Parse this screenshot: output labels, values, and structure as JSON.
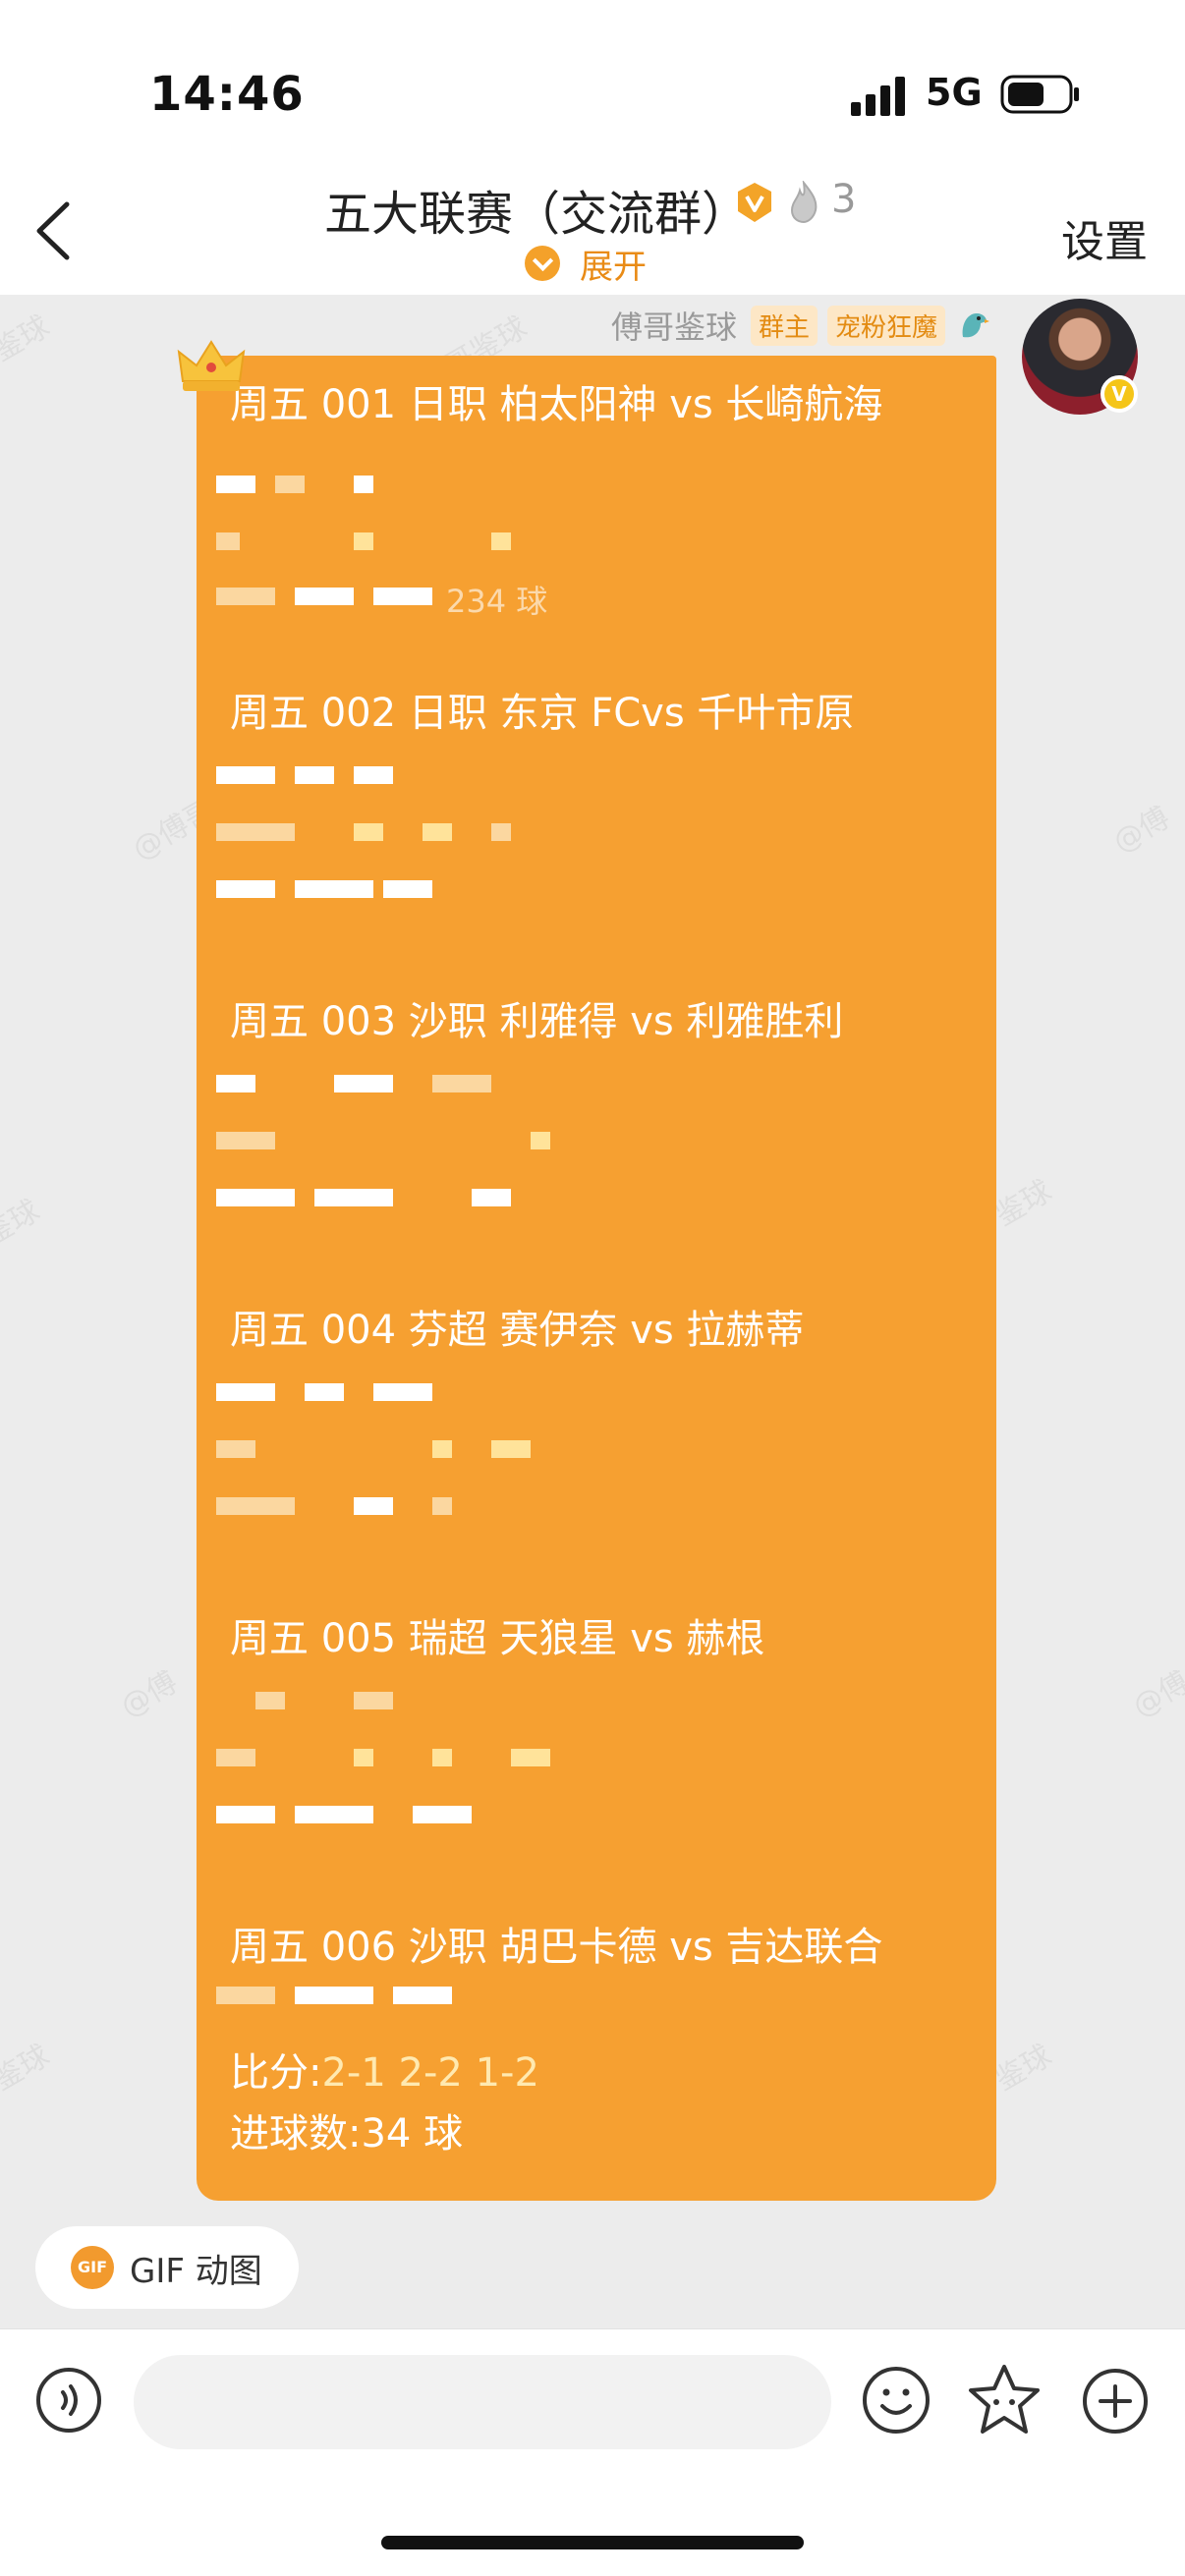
{
  "status_bar": {
    "time": "14:46",
    "network": "5G"
  },
  "header": {
    "title": "五大联赛（交流群）",
    "member_count": "3",
    "expand_label": "展开",
    "settings_label": "设置"
  },
  "message": {
    "sender_name": "傅哥鉴球",
    "tags": [
      "群主",
      "宠粉狂魔"
    ],
    "matches": [
      "周五 001 日职 柏太阳神 vs 长崎航海",
      "周五 002 日职 东京 FCvs 千叶市原",
      "周五 003 沙职 利雅得 vs 利雅胜利",
      "周五 004 芬超 赛伊奈 vs 拉赫蒂",
      "周五 005 瑞超 天狼星 vs 赫根",
      "周五 006 沙职 胡巴卡德 vs 吉达联合"
    ],
    "score_label": "比分:",
    "scores": "2-1  2-2  1-2",
    "goals_label": "进球数:34 球",
    "fragment_text": "234 球"
  },
  "gif_chip": {
    "icon_text": "GIF",
    "label": "GIF 动图"
  },
  "input": {
    "placeholder": ""
  },
  "colors": {
    "bubble": "#f6a031",
    "accent": "#e98b16",
    "chat_bg": "#ececec"
  },
  "icons": [
    "back-arrow-icon",
    "signal-icon",
    "battery-icon",
    "v-badge-icon",
    "flame-icon",
    "chevron-down-icon",
    "crown-icon",
    "bird-icon",
    "voice-icon",
    "emoji-icon",
    "sticker-icon",
    "plus-icon"
  ]
}
